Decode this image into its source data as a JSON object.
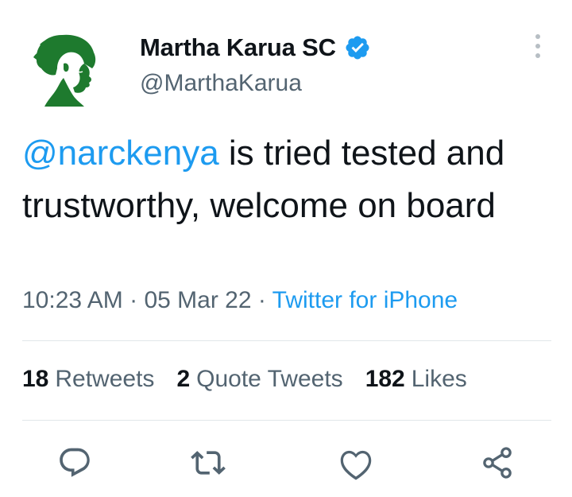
{
  "user": {
    "display_name": "Martha Karua SC",
    "handle": "@MarthaKarua",
    "verified": true,
    "avatar_color": "#1e7a2e"
  },
  "tweet": {
    "mention": "@narckenya",
    "text": " is tried tested and trustworthy, welcome on board",
    "time": "10:23 AM",
    "date": "05 Mar 22",
    "separator": "·",
    "source": "Twitter for iPhone"
  },
  "stats": {
    "retweets_count": "18",
    "retweets_label": "Retweets",
    "quotes_count": "2",
    "quotes_label": "Quote Tweets",
    "likes_count": "182",
    "likes_label": "Likes"
  },
  "actions": {
    "icons": [
      "reply-icon",
      "retweet-icon",
      "like-icon",
      "share-icon"
    ]
  },
  "colors": {
    "accent": "#1d9bf0",
    "secondary_text": "#536471",
    "primary_text": "#0f1419"
  }
}
